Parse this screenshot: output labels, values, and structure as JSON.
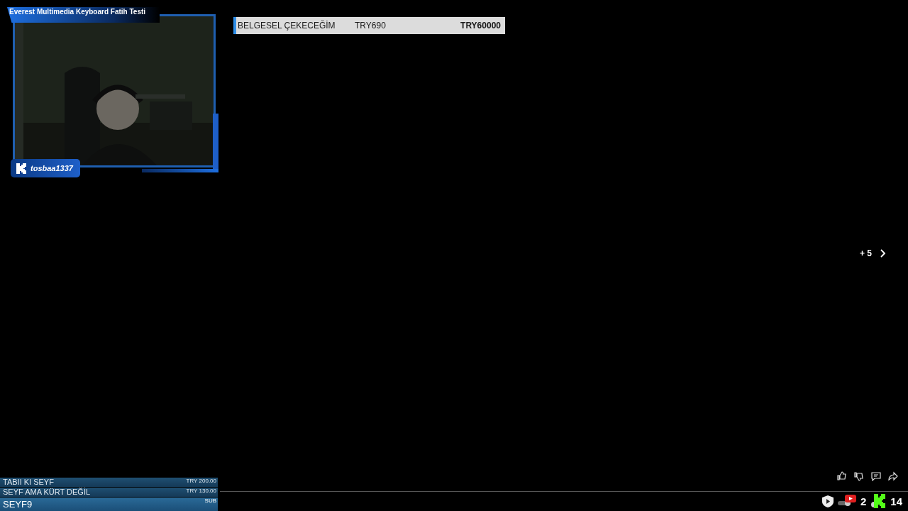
{
  "webcam": {
    "title": "Everest Multimedia Keyboard Fatih Testi",
    "username": "tosbaa1337"
  },
  "goal": {
    "label": "BELGESEL ÇEKECEĞİM",
    "current": "TRY690",
    "target": "TRY60000",
    "level": 0.0115
  },
  "pager": {
    "count": "+ 5"
  },
  "alerts": [
    {
      "kind": "donation",
      "name": "TABII KI SEYF",
      "amount": "TRY 200.00"
    },
    {
      "kind": "donation",
      "name": "SEYF AMA KÜRT DEĞİL",
      "amount": "TRY 130.00"
    },
    {
      "kind": "sub",
      "name": "SEYF9",
      "amount": "SUB"
    }
  ],
  "status": {
    "notifications": "2",
    "followers": "14"
  }
}
